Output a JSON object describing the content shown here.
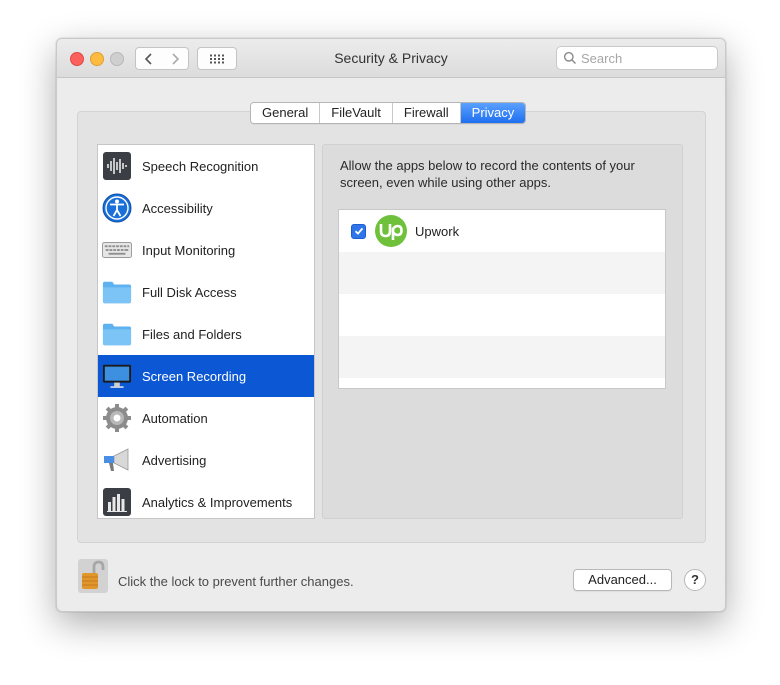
{
  "window": {
    "title": "Security & Privacy",
    "search_placeholder": "Search"
  },
  "tabs": [
    {
      "label": "General",
      "active": false
    },
    {
      "label": "FileVault",
      "active": false
    },
    {
      "label": "Firewall",
      "active": false
    },
    {
      "label": "Privacy",
      "active": true
    }
  ],
  "sidebar": {
    "items": [
      {
        "label": "Speech Recognition",
        "icon": "waveform-icon",
        "selected": false
      },
      {
        "label": "Accessibility",
        "icon": "accessibility-icon",
        "selected": false
      },
      {
        "label": "Input Monitoring",
        "icon": "keyboard-icon",
        "selected": false
      },
      {
        "label": "Full Disk Access",
        "icon": "folder-icon",
        "selected": false
      },
      {
        "label": "Files and Folders",
        "icon": "folder-icon",
        "selected": false
      },
      {
        "label": "Screen Recording",
        "icon": "display-icon",
        "selected": true
      },
      {
        "label": "Automation",
        "icon": "gear-icon",
        "selected": false
      },
      {
        "label": "Advertising",
        "icon": "megaphone-icon",
        "selected": false
      },
      {
        "label": "Analytics & Improvements",
        "icon": "bar-chart-icon",
        "selected": false
      }
    ]
  },
  "content": {
    "description": "Allow the apps below to record the contents of your screen, even while using other apps.",
    "apps": [
      {
        "name": "Upwork",
        "checked": true,
        "icon_text": "Up",
        "icon_color": "#6fc13c"
      }
    ]
  },
  "footer": {
    "lock_text": "Click the lock to prevent further changes.",
    "advanced_label": "Advanced...",
    "help_label": "?"
  },
  "colors": {
    "accent": "#1f6ff0",
    "selection": "#0c58d4",
    "close": "#fc605c",
    "minimize": "#fdbc40"
  }
}
